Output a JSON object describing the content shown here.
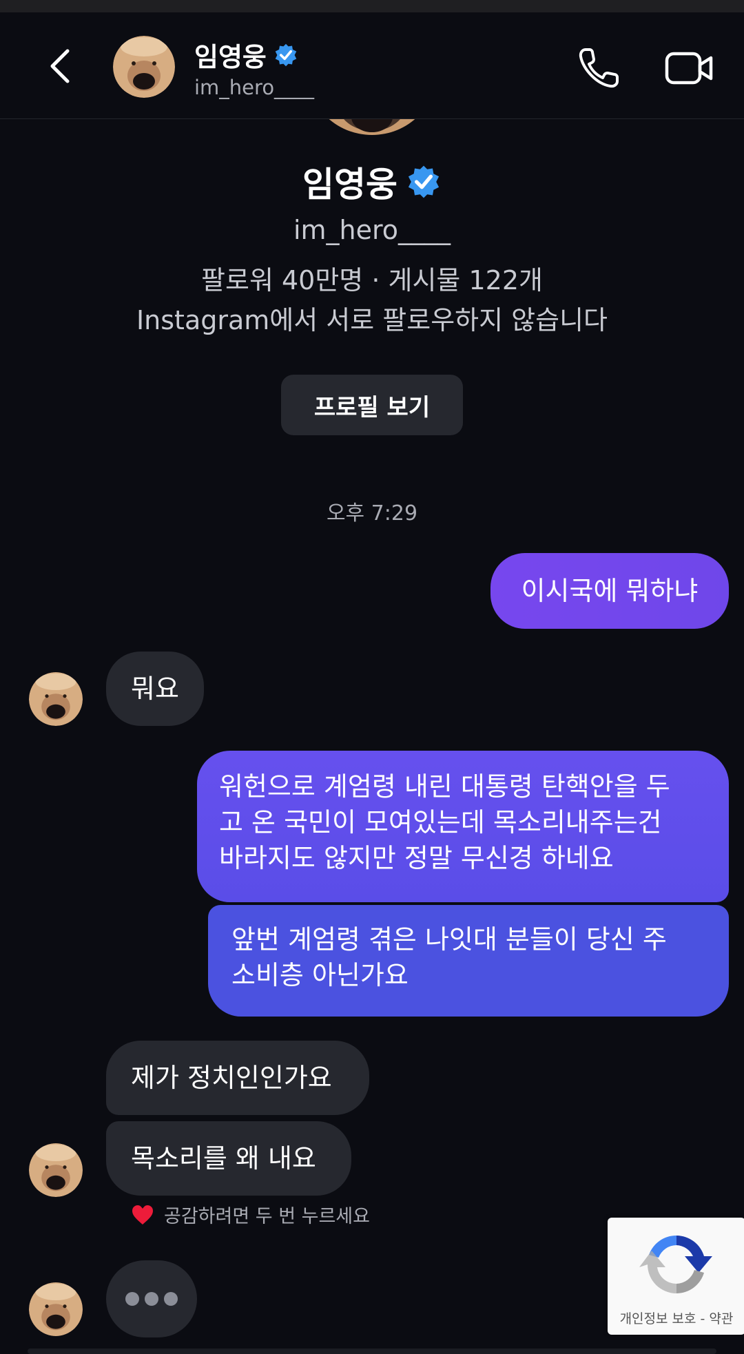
{
  "header": {
    "name": "임영웅",
    "handle": "im_hero____",
    "verified": true
  },
  "profile": {
    "name": "임영웅",
    "handle": "im_hero____",
    "stats": "팔로워 40만명 · 게시물 122개",
    "relationship": "Instagram에서 서로 팔로우하지 않습니다",
    "view_profile_label": "프로필 보기"
  },
  "timestamp": "오후 7:29",
  "messages": [
    {
      "from": "me",
      "text": "이시국에 뭐하냐"
    },
    {
      "from": "them",
      "text": "뭐요"
    },
    {
      "from": "me",
      "lines": [
        "워헌으로 계엄령 내린 대통령 탄핵안을 두",
        "고 온 국민이 모여있는데 목소리내주는건",
        "바라지도 않지만 정말 무신경 하네요"
      ]
    },
    {
      "from": "me",
      "lines": [
        "앞번 계엄령 겪은 나잇대 분들이 당신 주",
        "소비층 아닌가요"
      ]
    },
    {
      "from": "them",
      "text": "제가 정치인인가요"
    },
    {
      "from": "them",
      "text": "목소리를 왜 내요"
    }
  ],
  "react_hint": "공감하려면 두 번 누르세요",
  "recaptcha": {
    "links": "개인정보 보호 - 약관"
  },
  "colors": {
    "background": "#0b0c12",
    "incoming_bubble": "#26282f",
    "outgoing_purple": "#7747ee",
    "outgoing_blue": "#4b52e0",
    "verified_badge": "#3897f0"
  },
  "icons": [
    "back-icon",
    "phone-icon",
    "video-icon",
    "verified-icon",
    "heart-icon",
    "recaptcha-icon"
  ]
}
